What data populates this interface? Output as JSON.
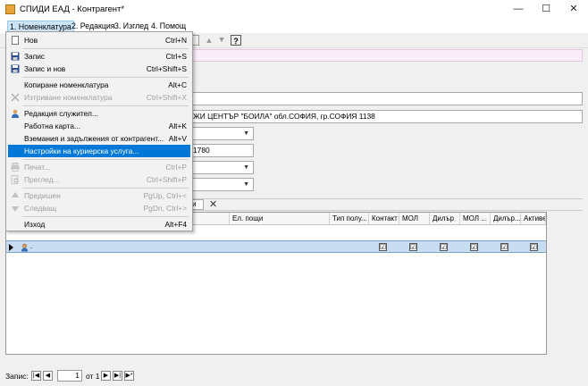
{
  "window": {
    "title": "СПИДИ ЕАД - Контрагент*",
    "controls": {
      "minimize": "—",
      "maximize": "☐",
      "close": "✕"
    }
  },
  "menubar": [
    {
      "label": "1. Номенклатура",
      "active": true
    },
    {
      "label": "2. Редакция"
    },
    {
      "label": "3. Изглед"
    },
    {
      "label": "4. Помощ"
    }
  ],
  "toolbar": {
    "up": "▲",
    "down": "▲",
    "help": "?"
  },
  "dropdown": {
    "items": [
      {
        "label": "Нов",
        "shortcut": "Ctrl+N",
        "icon": "new-doc-icon",
        "disabled": false
      },
      {
        "label": "Запис",
        "shortcut": "Ctrl+S",
        "icon": "save-icon",
        "disabled": false
      },
      {
        "label": "Запис и нов",
        "shortcut": "Ctrl+Shift+S",
        "icon": "save-new-icon",
        "disabled": false
      },
      {
        "label": "Копиране номенклатура",
        "shortcut": "Alt+C",
        "icon": "",
        "disabled": false
      },
      {
        "label": "Изтриване номенклатура",
        "shortcut": "Ctrl+Shift+X",
        "icon": "delete-icon",
        "disabled": true
      },
      {
        "label": "Редакция служител...",
        "shortcut": "",
        "icon": "user-icon",
        "disabled": false
      },
      {
        "label": "Работна карта...",
        "shortcut": "Alt+K",
        "icon": "",
        "disabled": false
      },
      {
        "label": "Вземания и задължения от контрагент...",
        "shortcut": "Alt+V",
        "icon": "",
        "disabled": false
      },
      {
        "label": "Настройки на куриерска услуга...",
        "shortcut": "",
        "icon": "",
        "disabled": false,
        "highlighted": true
      },
      {
        "label": "Печат...",
        "shortcut": "Ctrl+P",
        "icon": "print-icon",
        "disabled": true
      },
      {
        "label": "Преглед...",
        "shortcut": "Ctrl+Shift+P",
        "icon": "preview-icon",
        "disabled": true
      },
      {
        "label": "Предишен",
        "shortcut": "PgUp, Ctrl+<",
        "icon": "prev-icon",
        "disabled": true
      },
      {
        "label": "Следващ",
        "shortcut": "PgDn, Ctrl+>",
        "icon": "next-icon",
        "disabled": true
      },
      {
        "label": "Изход",
        "shortcut": "Alt+F4",
        "icon": "",
        "disabled": false
      }
    ]
  },
  "form": {
    "address_value": "ЖИ ЦЕНТЪР \"БОИЛА\" обл.СОФИЯ, гр.СОФИЯ 1138",
    "number_value": "1780"
  },
  "grid": {
    "columns": [
      "Ел. пощи",
      "Тип полу...",
      "Контакт",
      "МОЛ",
      "Дилър",
      "МОЛ ...",
      "Дилър...",
      "Активен"
    ],
    "row": {
      "name": ".",
      "checks": [
        "☑",
        "☑",
        "☑",
        "☑",
        "☑",
        "☑"
      ]
    }
  },
  "status": {
    "record_label": "Запис:",
    "current": "1",
    "of_label": "от 1"
  },
  "colors": {
    "highlight": "#0078d7",
    "row_selected": "#c8ddf2",
    "pink_bar": "#fbeefa"
  }
}
